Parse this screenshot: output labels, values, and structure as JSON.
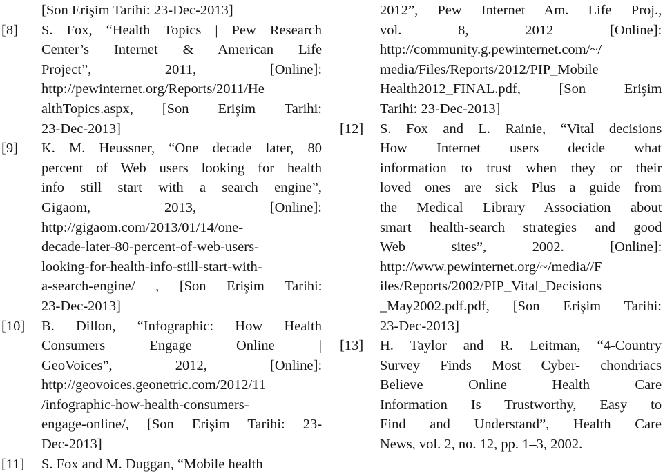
{
  "document": {
    "type": "references-page",
    "language": "tr-en",
    "column_count": 2,
    "background_color": "#ffffff",
    "text_color": "#161616"
  },
  "left_column": {
    "entries": [
      {
        "label": "",
        "continuation": true,
        "lines": [
          "[Son Erişim Tarihi: 23-Dec-2013]"
        ]
      },
      {
        "label": "[8]",
        "continuation": false,
        "lines": [
          "S. Fox, “Health Topics | Pew Research",
          "Center’s Internet & American Life",
          "Project”, 2011, [Online]:",
          "http://pewinternet.org/Reports/2011/He",
          "althTopics.aspx, [Son Erişim Tarihi:",
          "23-Dec-2013]"
        ]
      },
      {
        "label": "[9]",
        "continuation": false,
        "lines": [
          "K. M. Heussner, “One decade later, 80",
          "percent of Web users looking for health",
          "info still start with a search engine”,",
          "Gigaom, 2013, [Online]:",
          "http://gigaom.com/2013/01/14/one-",
          "decade-later-80-percent-of-web-users-",
          "looking-for-health-info-still-start-with-",
          "a-search-engine/ , [Son Erişim Tarihi:",
          "23-Dec-2013]"
        ]
      },
      {
        "label": "[10]",
        "continuation": false,
        "lines": [
          "B. Dillon, “Infographic: How Health",
          "Consumers Engage Online |",
          "GeoVoices”, 2012, [Online]:",
          "http://geovoices.geonetric.com/2012/11",
          "/infographic-how-health-consumers-",
          "engage-online/, [Son Erişim Tarihi: 23-",
          "Dec-2013]"
        ]
      },
      {
        "label": "[11]",
        "continuation": false,
        "lines": [
          "S. Fox and M. Duggan, “Mobile health"
        ]
      }
    ]
  },
  "right_column": {
    "entries": [
      {
        "label": "",
        "continuation": true,
        "lines": [
          "2012”, Pew Internet Am. Life Proj.,",
          "vol. 8, 2012 [Online]:",
          "http://community.g.pewinternet.com/~/",
          "media/Files/Reports/2012/PIP_Mobile",
          "Health2012_FINAL.pdf, [Son Erişim",
          "Tarihi: 23-Dec-2013]"
        ]
      },
      {
        "label": "[12]",
        "continuation": false,
        "lines": [
          "S. Fox and L. Rainie, “Vital decisions",
          "How Internet users decide what",
          "information to trust when they or their",
          "loved ones are sick Plus a guide from",
          "the Medical Library Association about",
          "smart health-search strategies and good",
          "Web sites”, 2002. [Online]:",
          "http://www.pewinternet.org/~/media//F",
          "iles/Reports/2002/PIP_Vital_Decisions",
          "_May2002.pdf.pdf, [Son Erişim Tarihi:",
          "23-Dec-2013]"
        ]
      },
      {
        "label": "[13]",
        "continuation": false,
        "lines": [
          "H. Taylor and R. Leitman, “4-Country",
          "Survey Finds Most Cyber- chondriacs",
          "Believe Online Health Care",
          "Information Is Trustworthy, Easy to",
          "Find and Understand”, Health Care",
          "News, vol. 2, no. 12, pp. 1–3, 2002."
        ]
      }
    ]
  }
}
